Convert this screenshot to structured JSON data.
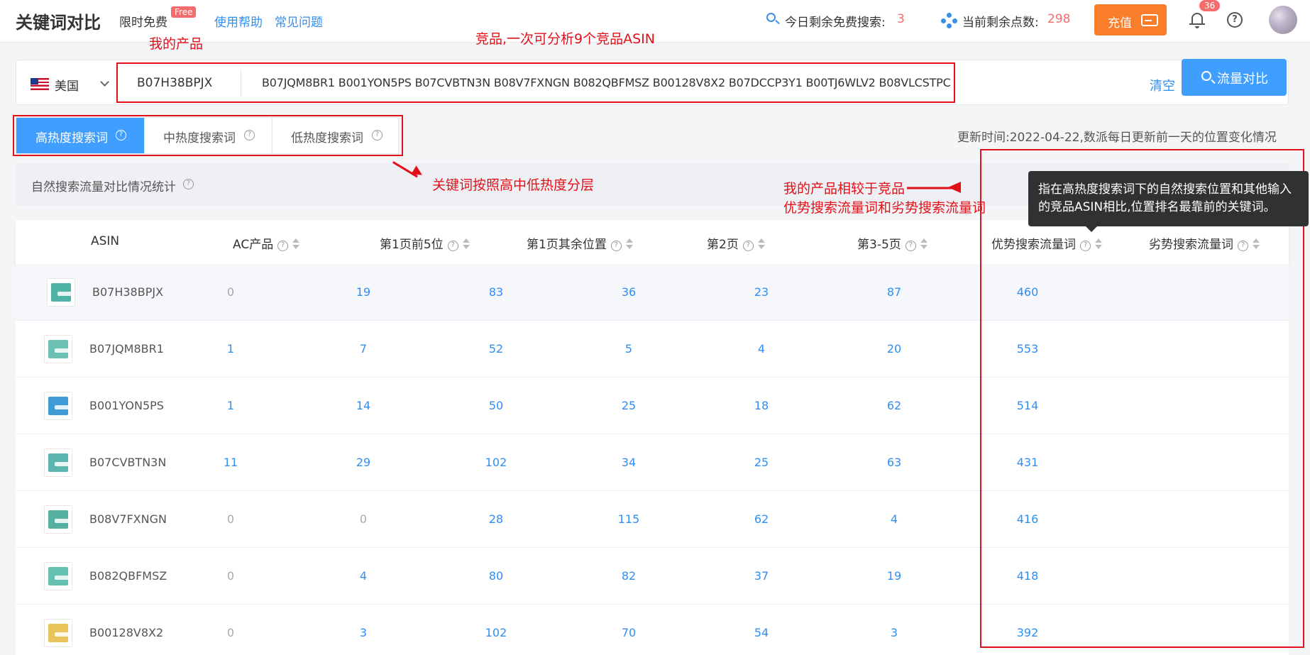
{
  "header": {
    "title": "关键词对比",
    "limited_free": "限时免费",
    "free_badge": "Free",
    "links": [
      "使用帮助",
      "常见问题"
    ],
    "today_label": "今日剩余免费搜索:",
    "today_value": "3",
    "points_label": "当前剩余点数:",
    "points_value": "298",
    "recharge_label": "充值",
    "notification_count": "36"
  },
  "search": {
    "country": "美国",
    "my_asin": "B07H38BPJX",
    "competitor_asins": "B07JQM8BR1 B001YON5PS B07CVBTN3N B08V7FXNGN B082QBFMSZ B00128V8X2 B07DCCP3Y1 B00TJ6WLV2 B08VLCSTPC",
    "clear_label": "清空",
    "compare_label": "流量对比"
  },
  "tabs": [
    {
      "label": "高热度搜索词",
      "active": true
    },
    {
      "label": "中热度搜索词",
      "active": false
    },
    {
      "label": "低热度搜索词",
      "active": false
    }
  ],
  "update_time": "更新时间:2022-04-22,数派每日更新前一天的位置变化情况",
  "stats_title": "自然搜索流量对比情况统计",
  "table": {
    "columns": [
      "ASIN",
      "AC产品",
      "第1页前5位",
      "第1页其余位置",
      "第2页",
      "第3-5页",
      "优势搜索流量词",
      "劣势搜索流量词"
    ],
    "rows": [
      {
        "asin": "B07H38BPJX",
        "values": [
          "0",
          "19",
          "83",
          "36",
          "23",
          "87",
          "460"
        ]
      },
      {
        "asin": "B07JQM8BR1",
        "values": [
          "1",
          "7",
          "52",
          "5",
          "4",
          "20",
          "553"
        ]
      },
      {
        "asin": "B001YON5PS",
        "values": [
          "1",
          "14",
          "50",
          "25",
          "18",
          "62",
          "514"
        ]
      },
      {
        "asin": "B07CVBTN3N",
        "values": [
          "11",
          "29",
          "102",
          "34",
          "25",
          "63",
          "431"
        ]
      },
      {
        "asin": "B08V7FXNGN",
        "values": [
          "0",
          "0",
          "28",
          "115",
          "62",
          "4",
          "416"
        ]
      },
      {
        "asin": "B082QBFMSZ",
        "values": [
          "0",
          "4",
          "80",
          "82",
          "37",
          "19",
          "418"
        ]
      },
      {
        "asin": "B00128V8X2",
        "values": [
          "0",
          "3",
          "102",
          "70",
          "54",
          "3",
          "392"
        ]
      }
    ]
  },
  "tooltip": "指在高热度搜索词下的自然搜索位置和其他输入的竞品ASIN相比,位置排名最靠前的关键词。",
  "annotations": {
    "my_product": "我的产品",
    "competitors": "竞品,一次可分析9个竞品ASIN",
    "tiers": "关键词按照高中低热度分层",
    "compare_line1": "我的产品相较于竞品",
    "compare_line2": "优势搜索流量词和劣势搜索流量词"
  },
  "colors": {
    "accent": "#409eff",
    "link": "#2f8ef4",
    "warn": "#f56c6c",
    "recharge": "#fa7d2b",
    "annotation": "#e3101a"
  }
}
